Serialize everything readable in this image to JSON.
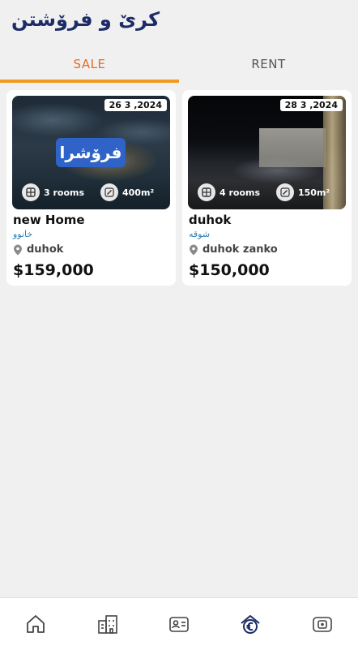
{
  "header": {
    "title": "کرێ و فرۆشتن"
  },
  "tabs": [
    {
      "label": "SALE",
      "active": true
    },
    {
      "label": "RENT",
      "active": false
    }
  ],
  "listings": [
    {
      "date": "26 3 ,2024",
      "status_badge": "فرۆشرا",
      "rooms": "3 rooms",
      "area": "400m²",
      "title": "new Home",
      "type": "خانوو",
      "location": "duhok",
      "price": "$159,000"
    },
    {
      "date": "28 3 ,2024",
      "rooms": "4 rooms",
      "area": "150m²",
      "title": "duhok",
      "type": "شوقە",
      "location": "duhok zanko",
      "price": "$150,000"
    }
  ],
  "bottom_nav": [
    {
      "icon": "home-icon",
      "active": false
    },
    {
      "icon": "buildings-icon",
      "active": false
    },
    {
      "icon": "id-card-icon",
      "active": false
    },
    {
      "icon": "euro-house-icon",
      "active": true
    },
    {
      "icon": "wallet-icon",
      "active": false
    }
  ],
  "colors": {
    "accent": "#e86a23",
    "tab_underline": "#f29a1f",
    "title": "#1d2b66",
    "sold_badge": "#2f63c8",
    "type_text": "#2f7fb3",
    "nav_active": "#1d2b66"
  }
}
